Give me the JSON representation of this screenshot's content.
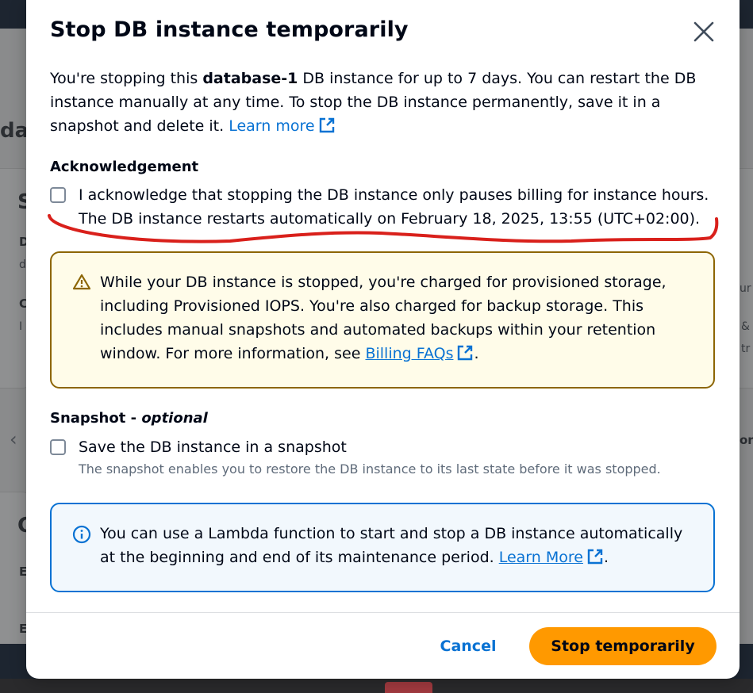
{
  "modal": {
    "title": "Stop DB instance temporarily",
    "intro_1": "You're stopping this ",
    "db_name": "database-1",
    "intro_2": " DB instance for up to 7 days. You can restart the DB instance manually at any time. To stop the DB instance permanently, save it in a snapshot and delete it. ",
    "learn_more": "Learn more",
    "acknowledgement": {
      "heading": "Acknowledgement",
      "checked": false,
      "line1": "I acknowledge that stopping the DB instance only pauses billing for instance hours.",
      "line2": "The DB instance restarts automatically on February 18, 2025, 13:55 (UTC+02:00)."
    },
    "warning": {
      "text": "While your DB instance is stopped, you're charged for provisioned storage, including Provisioned IOPS. You're also charged for backup storage. This includes manual snapshots and automated backups within your retention window. For more information, see ",
      "link": "Billing FAQs",
      "suffix": "."
    },
    "snapshot": {
      "heading": "Snapshot - ",
      "heading_optional": "optional",
      "checked": false,
      "label": "Save the DB instance in a snapshot",
      "description": "The snapshot enables you to restore the DB instance to its last state before it was stopped."
    },
    "info": {
      "text": "You can use a Lambda function to start and stop a DB instance automatically at the beginning and end of its maintenance period. ",
      "link": "Learn More",
      "suffix": "."
    },
    "cancel_label": "Cancel",
    "primary_label": "Stop temporarily"
  },
  "background": {
    "fragments": [
      "da",
      "S",
      "D",
      "d",
      "C",
      "I",
      "C",
      "E",
      "E",
      "or",
      "ur",
      "&",
      "tr"
    ]
  },
  "colors": {
    "primary": "#ff9900",
    "link": "#0972d3",
    "warning_border": "#8d6605",
    "info_border": "#0972d3",
    "annotation": "#d9201b"
  }
}
